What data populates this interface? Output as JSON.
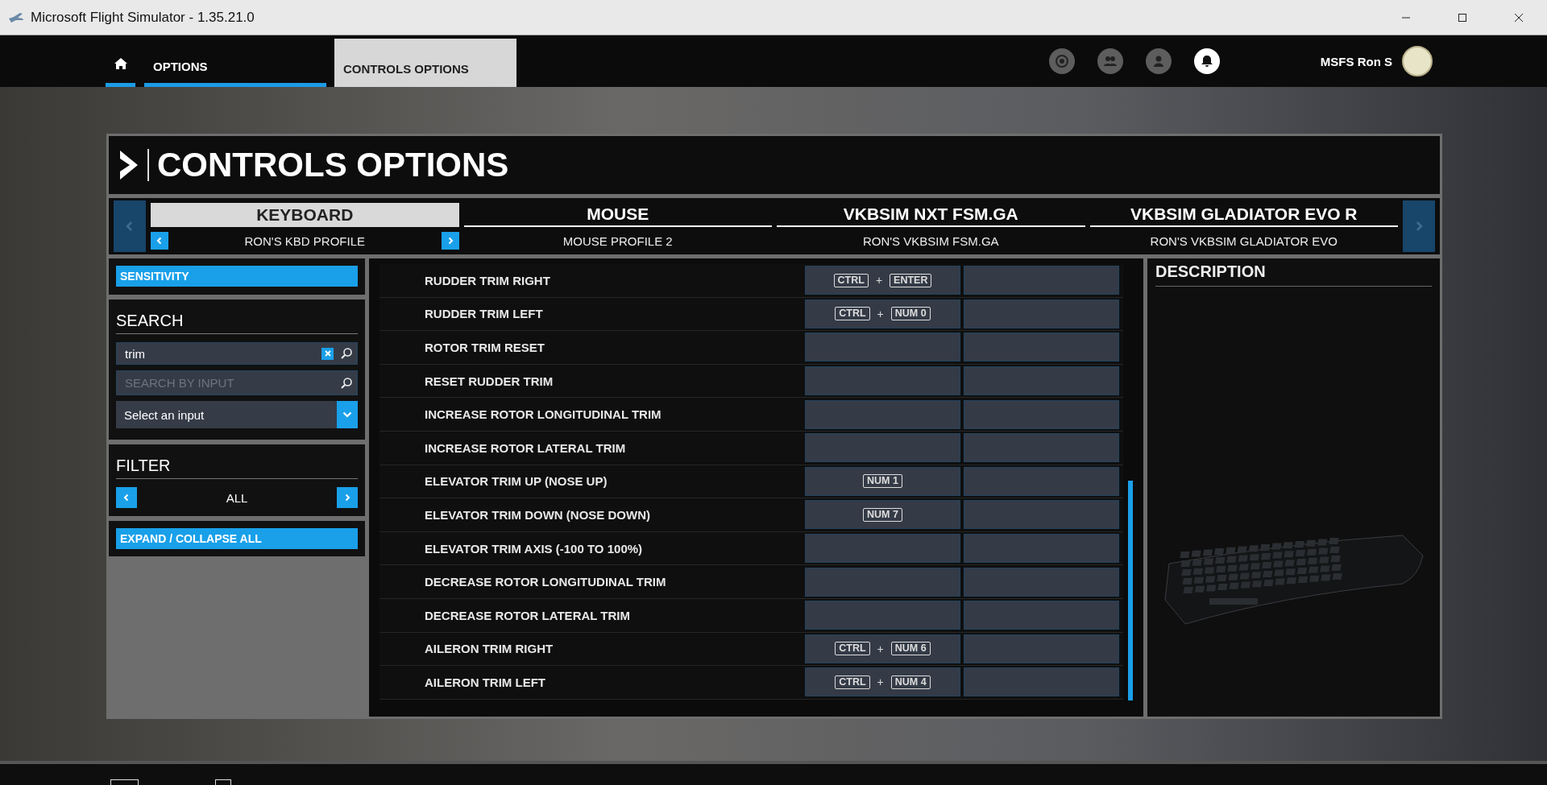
{
  "window": {
    "title": "Microsoft Flight Simulator - 1.35.21.0"
  },
  "breadcrumbs": [
    {
      "label": "OPTIONS",
      "selected": false
    },
    {
      "label": "CONTROLS OPTIONS",
      "selected": true
    }
  ],
  "user": {
    "name": "MSFS Ron S"
  },
  "page_title": "CONTROLS OPTIONS",
  "devices": [
    {
      "name": "KEYBOARD",
      "profile": "RON'S KBD PROFILE",
      "selected": true
    },
    {
      "name": "MOUSE",
      "profile": "MOUSE PROFILE 2",
      "selected": false
    },
    {
      "name": "VKBSIM NXT FSM.GA",
      "profile": "RON'S VKBSIM FSM.GA",
      "selected": false
    },
    {
      "name": "VKBSIM GLADIATOR EVO R",
      "profile": "RON'S VKBSIM GLADIATOR EVO",
      "selected": false
    }
  ],
  "sidebar": {
    "sensitivity_button": "SENSITIVITY",
    "search": {
      "heading": "SEARCH",
      "value": "trim",
      "input_placeholder": "SEARCH BY INPUT",
      "select_value": "Select an input"
    },
    "filter": {
      "heading": "FILTER",
      "value": "ALL"
    },
    "expand_button": "EXPAND / COLLAPSE ALL"
  },
  "bindings": [
    {
      "action": "RUDDER TRIM RIGHT",
      "primary": {
        "keys": [
          "CTRL",
          "ENTER"
        ],
        "separator": "+"
      }
    },
    {
      "action": "RUDDER TRIM LEFT",
      "primary": {
        "keys": [
          "CTRL",
          "NUM 0"
        ],
        "separator": "+"
      }
    },
    {
      "action": "ROTOR TRIM RESET"
    },
    {
      "action": "RESET RUDDER TRIM"
    },
    {
      "action": "INCREASE ROTOR LONGITUDINAL TRIM"
    },
    {
      "action": "INCREASE ROTOR LATERAL TRIM"
    },
    {
      "action": "ELEVATOR TRIM UP (NOSE UP)",
      "primary": {
        "keys": [
          "NUM 1"
        ]
      }
    },
    {
      "action": "ELEVATOR TRIM DOWN (NOSE DOWN)",
      "primary": {
        "keys": [
          "NUM 7"
        ]
      }
    },
    {
      "action": "ELEVATOR TRIM AXIS (-100 TO 100%)"
    },
    {
      "action": "DECREASE ROTOR LONGITUDINAL TRIM"
    },
    {
      "action": "DECREASE ROTOR LATERAL TRIM"
    },
    {
      "action": "AILERON TRIM RIGHT",
      "primary": {
        "keys": [
          "CTRL",
          "NUM 6"
        ],
        "separator": "+"
      }
    },
    {
      "action": "AILERON TRIM LEFT",
      "primary": {
        "keys": [
          "CTRL",
          "NUM 4"
        ],
        "separator": "+"
      }
    }
  ],
  "description": {
    "heading": "DESCRIPTION"
  }
}
